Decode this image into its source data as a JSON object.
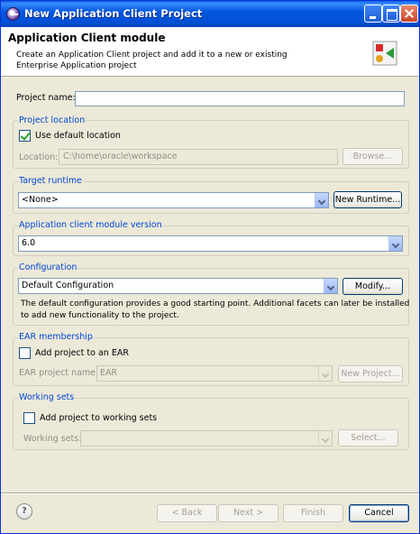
{
  "window": {
    "title": "New Application Client Project"
  },
  "banner": {
    "heading": "Application Client module",
    "description": "Create an Application Client project and add it to a new or existing Enterprise Application project"
  },
  "project_name": {
    "label": "Project name:",
    "value": ""
  },
  "project_location": {
    "title": "Project location",
    "use_default_label": "Use default location",
    "use_default_checked": true,
    "location_label": "Location:",
    "location_value": "C:\\home\\oracle\\workspace",
    "browse_label": "Browse..."
  },
  "target_runtime": {
    "title": "Target runtime",
    "selected": "<None>",
    "new_runtime_label": "New Runtime..."
  },
  "module_version": {
    "title": "Application client module version",
    "selected": "6.0"
  },
  "configuration": {
    "title": "Configuration",
    "selected": "Default Configuration",
    "modify_label": "Modify...",
    "description_line1": "The default configuration provides a good starting point. Additional facets can later be installed",
    "description_line2": "to add new functionality to the project."
  },
  "ear_membership": {
    "title": "EAR membership",
    "add_label": "Add project to an EAR",
    "add_checked": false,
    "ear_name_label": "EAR project name:",
    "ear_name_selected": "EAR",
    "new_project_label": "New Project..."
  },
  "working_sets": {
    "title": "Working sets",
    "add_label": "Add project to working sets",
    "add_checked": false,
    "sets_label": "Working sets:",
    "sets_selected": "",
    "select_label": "Select..."
  },
  "footer": {
    "help": "?",
    "back": "< Back",
    "next": "Next >",
    "finish": "Finish",
    "cancel": "Cancel"
  },
  "icons": [
    "app-icon",
    "minimize-icon",
    "maximize-icon",
    "close-icon",
    "wizard-icon",
    "help-icon"
  ]
}
